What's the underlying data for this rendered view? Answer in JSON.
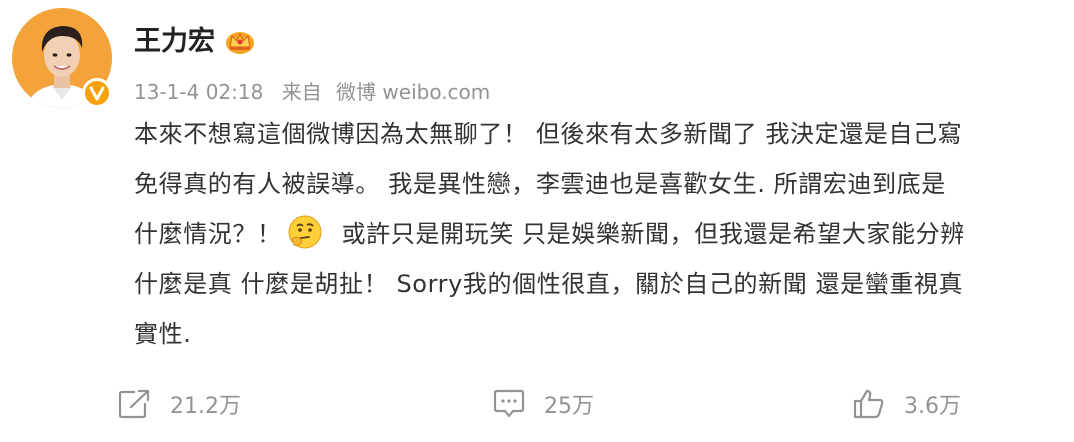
{
  "post": {
    "author": "王力宏",
    "timestamp": "13-1-4 02:18",
    "source_prefix": "来自",
    "source_name": "微博 weibo.com",
    "content_lines": [
      "本來不想寫這個微博因為太無聊了！ 但後來有太多新聞了 我決定還是自己寫",
      "免得真的有人被誤導。 我是異性戀，李雲迪也是喜歡女生. 所謂宏迪到底是",
      "什麼情況？！",
      "或許只是開玩笑 只是娛樂新聞，但我還是希望大家能分辨",
      "什麼是真 什麼是胡扯！ Sorry我的個性很直，關於自己的新聞 還是蠻重視真",
      "實性."
    ],
    "icons": {
      "avatar": "avatar",
      "verified": "verified-badge-icon",
      "membership": "crown-icon",
      "emoji": "thinking-emoji-icon",
      "repost": "repost-icon",
      "comment": "comment-icon",
      "like": "like-icon"
    }
  },
  "actions": {
    "repost_count": "21.2万",
    "comment_count": "25万",
    "like_count": "3.6万"
  },
  "colors": {
    "text": "#333333",
    "muted": "#939393",
    "verified": "#f7a10d",
    "avatar_bg": "#f3a33a"
  }
}
